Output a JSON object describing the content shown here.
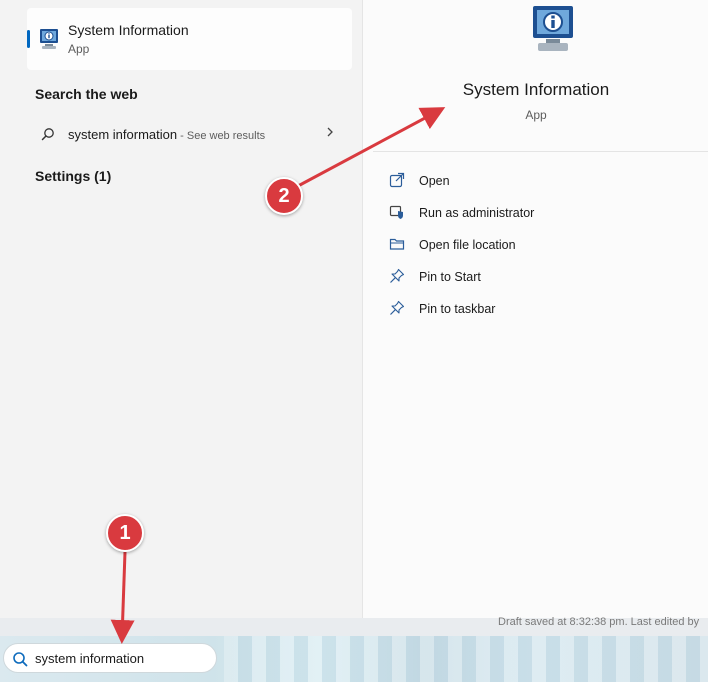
{
  "best_match": {
    "title": "System Information",
    "subtitle": "App",
    "icon": "system-information-icon"
  },
  "search_web": {
    "heading": "Search the web",
    "query": "system information",
    "suffix": " - See web results"
  },
  "settings": {
    "heading": "Settings (1)"
  },
  "detail": {
    "title": "System Information",
    "subtitle": "App",
    "actions": [
      {
        "label": "Open",
        "icon": "open-external-icon"
      },
      {
        "label": "Run as administrator",
        "icon": "shield-icon"
      },
      {
        "label": "Open file location",
        "icon": "folder-icon"
      },
      {
        "label": "Pin to Start",
        "icon": "pin-icon"
      },
      {
        "label": "Pin to taskbar",
        "icon": "pin-icon"
      }
    ]
  },
  "background": {
    "draft_status": "Draft saved at 8:32:38 pm. Last edited by"
  },
  "taskbar": {
    "search_value": "system information"
  },
  "annotations": {
    "step1": "1",
    "step2": "2",
    "color": "#d93a3f"
  }
}
